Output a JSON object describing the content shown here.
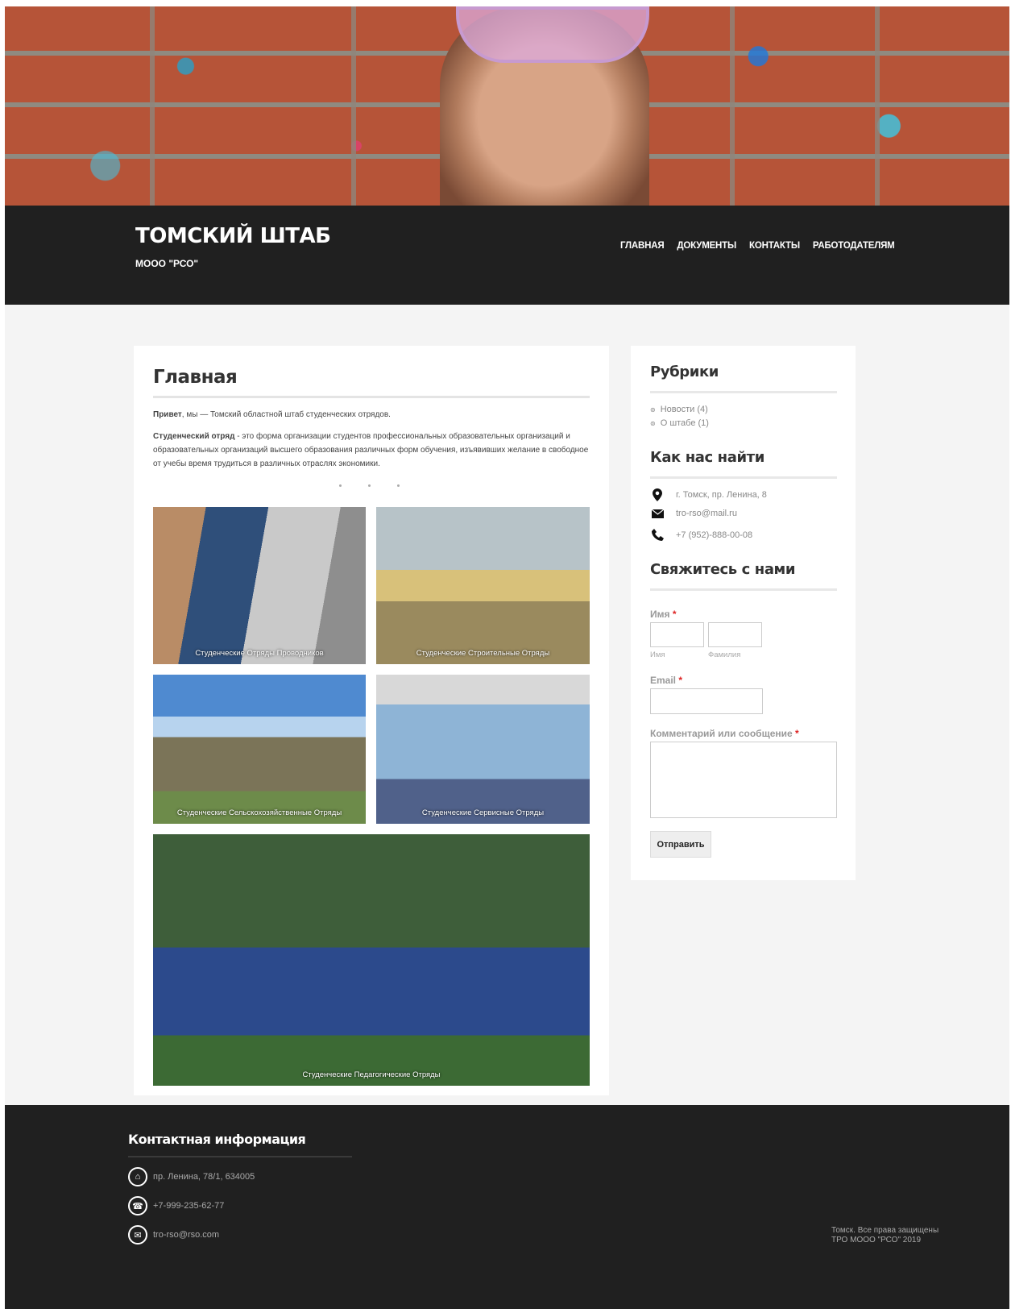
{
  "header": {
    "site_title": "ТОМСКИЙ ШТАБ",
    "site_subtitle": "МООО \"РСО\"",
    "nav": [
      "ГЛАВНАЯ",
      "ДОКУМЕНТЫ",
      "КОНТАКТЫ",
      "РАБОТОДАТЕЛЯМ"
    ]
  },
  "main": {
    "title": "Главная",
    "intro_bold": "Привет",
    "intro_rest": ", мы — Томский областной штаб студенческих отрядов.",
    "def_bold": "Студенческий отряд",
    "def_rest": " - это форма организации студентов профессиональных образовательных организаций и образовательных организаций высшего образования различных форм обучения, изъявивших желание в свободное от учебы время трудиться в различных отраслях экономики.",
    "gallery": [
      "Студенческие Отряды Проводников",
      "Студенческие Строительные Отряды",
      "Студенческие Сельскохозяйственные Отряды",
      "Студенческие Сервисные Отряды",
      "Студенческие Педагогические Отряды"
    ]
  },
  "sidebar": {
    "categories_title": "Рубрики",
    "categories": [
      "Новости (4)",
      "О штабе (1)"
    ],
    "find_title": "Как нас найти",
    "address": "г. Томск, пр. Ленина, 8",
    "email": "tro-rso@mail.ru",
    "phone": "+7 (952)-888-00-08",
    "contact_title": "Свяжитесь с нами",
    "form": {
      "name_label": "Имя",
      "first_sub": "Имя",
      "last_sub": "Фамилия",
      "email_label": "Email",
      "comment_label": "Комментарий или сообщение",
      "required_mark": "*",
      "submit": "Отправить"
    }
  },
  "footer": {
    "title": "Контактная информация",
    "address": "пр. Ленина, 78/1, 634005",
    "phone": "+7-999-235-62-77",
    "email": "tro-rso@rso.com",
    "copyright_1": "Томск. Все права защищены",
    "copyright_2": "ТРО МООО \"РСО\" 2019"
  },
  "colors": {
    "dark_bar": "#202020",
    "background": "#f4f4f4",
    "required": "#dd2222"
  }
}
